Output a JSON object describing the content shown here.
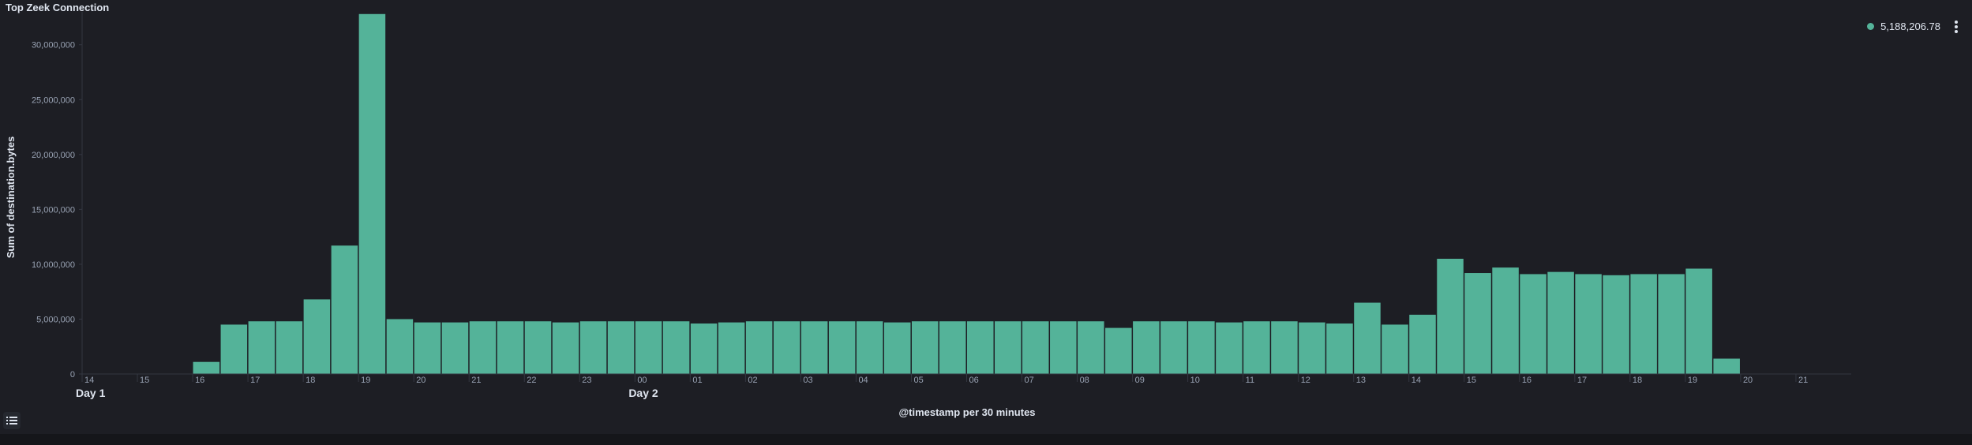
{
  "panel": {
    "title": "Top Zeek Connection",
    "legend_value": "5,188,206.78",
    "legend_color": "#54b399",
    "menu_icon": "vertical-ellipsis-icon",
    "legend_toggle_icon": "list-icon"
  },
  "chart_data": {
    "type": "bar",
    "title": "Top Zeek Connection",
    "xlabel": "@timestamp per 30 minutes",
    "ylabel": "Sum of destination.bytes",
    "ylim": [
      0,
      33000000
    ],
    "yticks": [
      0,
      5000000,
      10000000,
      15000000,
      20000000,
      25000000,
      30000000
    ],
    "ytick_labels": [
      "0",
      "5,000,000",
      "10,000,000",
      "15,000,000",
      "20,000,000",
      "25,000,000",
      "30,000,000"
    ],
    "grid": false,
    "legend_position": "top-right",
    "bar_color": "#54b399",
    "x_labels": [
      "14",
      "15",
      "16",
      "17",
      "18",
      "19",
      "20",
      "21",
      "22",
      "23",
      "00",
      "01",
      "02",
      "03",
      "04",
      "05",
      "06",
      "07",
      "08",
      "09",
      "10",
      "11",
      "12",
      "13",
      "14",
      "15",
      "16",
      "17",
      "18",
      "19",
      "20",
      "21"
    ],
    "day_labels": [
      {
        "text": "Day 1",
        "at_label_index": 0
      },
      {
        "text": "Day 2",
        "at_label_index": 10
      }
    ],
    "series": [
      {
        "name": "5,188,206.78",
        "values": [
          0,
          0,
          0,
          0,
          1100000,
          4500000,
          4800000,
          4800000,
          6800000,
          11700000,
          32800000,
          5000000,
          4700000,
          4700000,
          4800000,
          4800000,
          4800000,
          4700000,
          4800000,
          4800000,
          4800000,
          4800000,
          4600000,
          4700000,
          4800000,
          4800000,
          4800000,
          4800000,
          4800000,
          4700000,
          4800000,
          4800000,
          4800000,
          4800000,
          4800000,
          4800000,
          4800000,
          4200000,
          4800000,
          4800000,
          4800000,
          4700000,
          4800000,
          4800000,
          4700000,
          4600000,
          6500000,
          4500000,
          5400000,
          10500000,
          9200000,
          9700000,
          9100000,
          9300000,
          9100000,
          9000000,
          9100000,
          9100000,
          9600000,
          1400000,
          0,
          0,
          0,
          0
        ]
      }
    ]
  }
}
